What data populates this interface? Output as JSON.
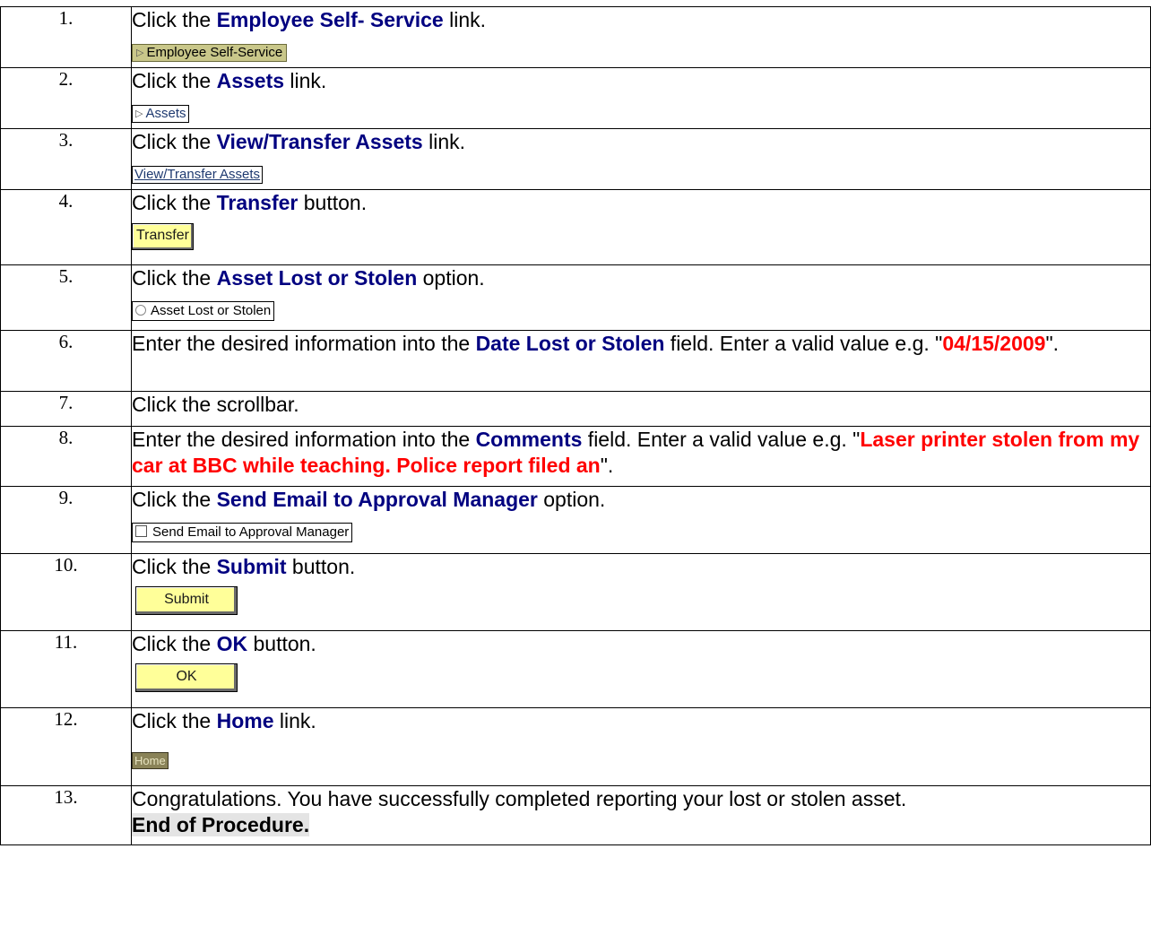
{
  "steps": [
    {
      "num": "1.",
      "pre": "Click the ",
      "bold": "Employee Self- Service",
      "post": " link.",
      "shot_label": "Employee Self-Service"
    },
    {
      "num": "2.",
      "pre": "Click the ",
      "bold": "Assets",
      "post": " link.",
      "shot_label": "Assets"
    },
    {
      "num": "3.",
      "pre": "Click the ",
      "bold": "View/Transfer Assets",
      "post": " link.",
      "shot_label": "View/Transfer Assets"
    },
    {
      "num": "4.",
      "pre": "Click the ",
      "bold": "Transfer",
      "post": " button.",
      "shot_label": "Transfer"
    },
    {
      "num": "5.",
      "pre": "Click the ",
      "bold": "Asset Lost or Stolen",
      "post": " option.",
      "shot_label": "Asset Lost or Stolen"
    },
    {
      "num": "6.",
      "pre": "Enter the desired information into the ",
      "bold": "Date Lost or Stolen",
      "mid": " field. Enter a valid value e.g. \"",
      "value": "04/15/2009",
      "post": "\"."
    },
    {
      "num": "7.",
      "text": "Click the scrollbar."
    },
    {
      "num": "8.",
      "pre": "Enter the desired information into the ",
      "bold": "Comments",
      "mid": " field. Enter a valid value e.g. \"",
      "value": "Laser printer stolen from my car at BBC while teaching. Police report filed an",
      "post": "\"."
    },
    {
      "num": "9.",
      "pre": "Click the ",
      "bold": "Send Email to Approval Manager",
      "post": " option.",
      "shot_label": "Send Email to Approval Manager"
    },
    {
      "num": "10.",
      "pre": "Click the ",
      "bold": "Submit",
      "post": " button.",
      "shot_label": "Submit"
    },
    {
      "num": "11.",
      "pre": "Click the ",
      "bold": "OK",
      "post": " button.",
      "shot_label": "OK"
    },
    {
      "num": "12.",
      "pre": "Click the ",
      "bold": "Home",
      "post": " link.",
      "shot_label": "Home"
    },
    {
      "num": "13.",
      "text": "Congratulations. You have successfully completed reporting your lost or stolen asset.",
      "end": "End of Procedure."
    }
  ]
}
